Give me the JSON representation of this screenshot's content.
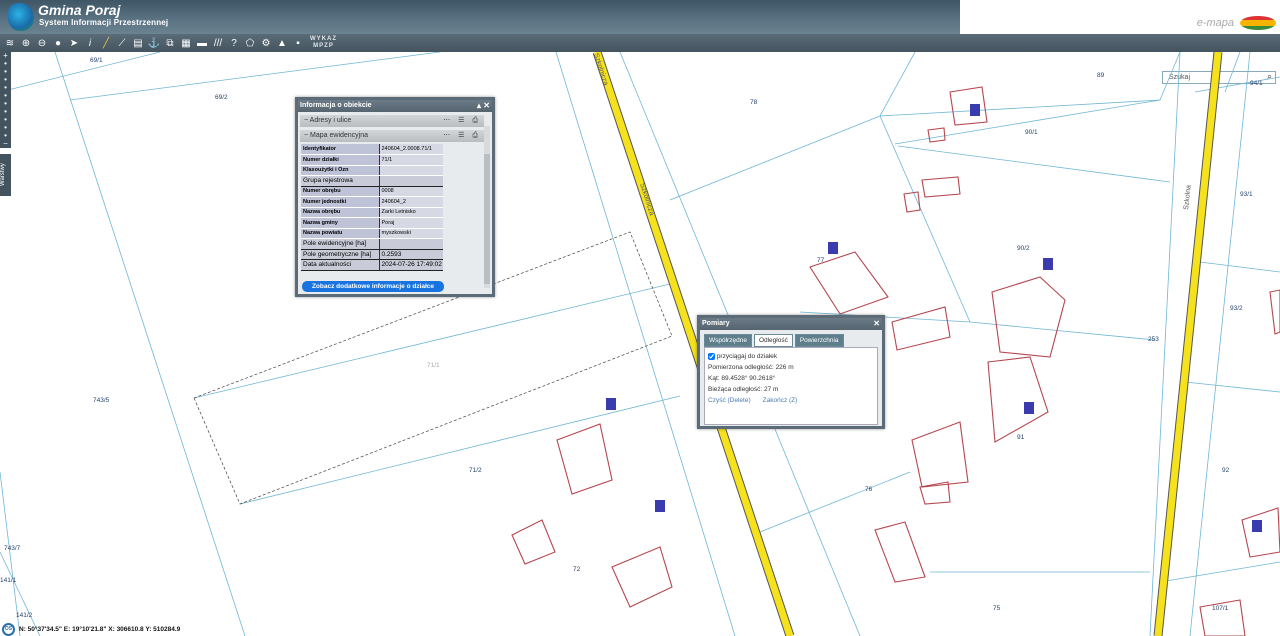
{
  "header": {
    "title": "Gmina Poraj",
    "subtitle": "System Informacji Przestrzennej",
    "brand": "e-mapa",
    "wykaz": "WYKAZ",
    "mpzp": "MPZP"
  },
  "search": {
    "placeholder": "Szukaj"
  },
  "sidebar": {
    "layers_label": "Warstwy"
  },
  "info_panel": {
    "title": "Informacja o obiekcie",
    "sections": [
      "Adresy i ulice",
      "Mapa ewidencyjna"
    ],
    "rows": [
      [
        "Identyfikator",
        "240604_2.0008.71/1"
      ],
      [
        "Numer działki",
        "71/1"
      ],
      [
        "Klasoużytki i Ozn",
        ""
      ],
      [
        "Grupa rejestrowa",
        ""
      ],
      [
        "Numer obrębu",
        "0008"
      ],
      [
        "Numer jednostki",
        "240604_2"
      ],
      [
        "Nazwa obrębu",
        "Zarki Letnisko"
      ],
      [
        "Nazwa gminy",
        "Poraj"
      ],
      [
        "Nazwa powiatu",
        "myszkowski"
      ],
      [
        "Pole ewidencyjne [ha]",
        ""
      ],
      [
        "Pole geometryczne [ha]",
        "0.2593"
      ],
      [
        "Data aktualności",
        "2024-07-26 17:49:02"
      ]
    ],
    "button": "Zobacz dodatkowe informacje o działce"
  },
  "measure_panel": {
    "title": "Pomiary",
    "tabs": [
      "Współrzędne",
      "Odległość",
      "Powierzchnia"
    ],
    "active_tab": 1,
    "snap_label": "przyciągaj do działek",
    "snap_checked": true,
    "measured": "Pomierzona odległość: 226 m",
    "angle": "Kąt: 89.4528° 90.2618°",
    "current": "Bieżąca odległość: 27 m",
    "clear": "Czyść (Delete)",
    "finish": "Zakończ (Z)"
  },
  "status": {
    "os": "OS",
    "coords": "N: 50°37'34.5\"  E: 19°10'21.8\"  X: 306610.8  Y: 510284.9"
  },
  "map": {
    "parcels": [
      "69/1",
      "69/2",
      "78",
      "89",
      "94/1",
      "90/1",
      "93/1",
      "77",
      "90/2",
      "93/2",
      "253",
      "71/1",
      "743/5",
      "91",
      "92",
      "76",
      "71/2",
      "72",
      "743/7",
      "141/1",
      "141/2",
      "75",
      "107/1"
    ],
    "roads": [
      "Szkolnicza",
      "Szkolnicza",
      "Szkolna"
    ]
  },
  "colors": {
    "road": "#f5e21c",
    "parcel_line": "#6fb6d6",
    "building": "#b5474f"
  }
}
